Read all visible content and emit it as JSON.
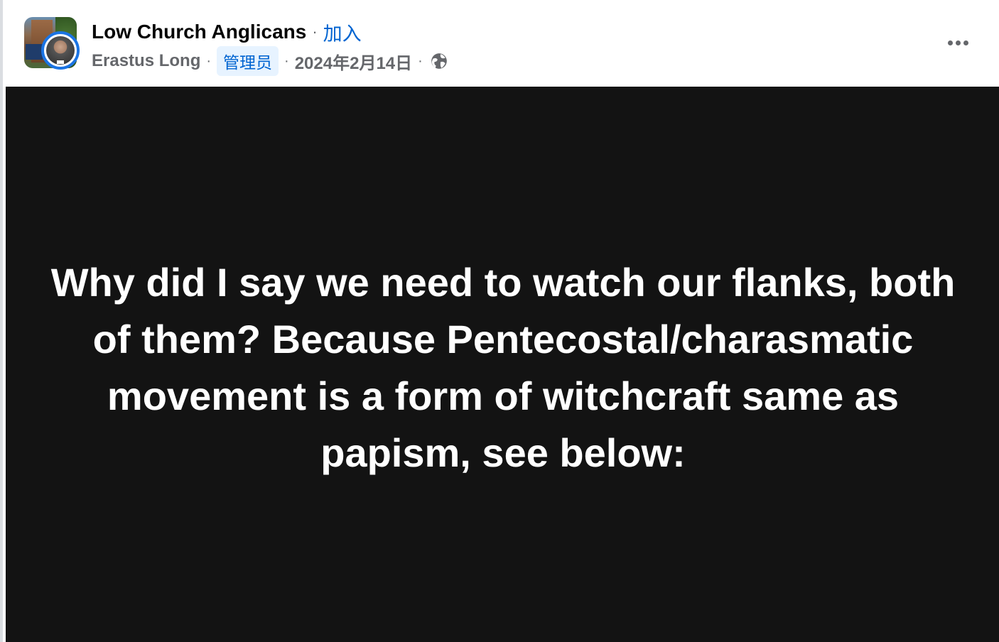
{
  "post": {
    "group_name": "Low Church Anglicans",
    "join_label": "加入",
    "author_name": "Erastus Long",
    "author_role_badge": "管理员",
    "date": "2024年2月14日",
    "privacy_icon": "globe-icon",
    "more_icon": "more-options-icon",
    "text_background_color": "#131313",
    "text_color": "#ffffff",
    "body_text": "Why did I say we need to watch our flanks, both of them? Because Pentecostal/charasmatic movement is a form of witchcraft same as papism, see below:"
  },
  "colors": {
    "link_blue": "#0064d1",
    "badge_background": "#e7f3ff",
    "secondary_text": "#65676b",
    "avatar_ring": "#1b74e4"
  }
}
